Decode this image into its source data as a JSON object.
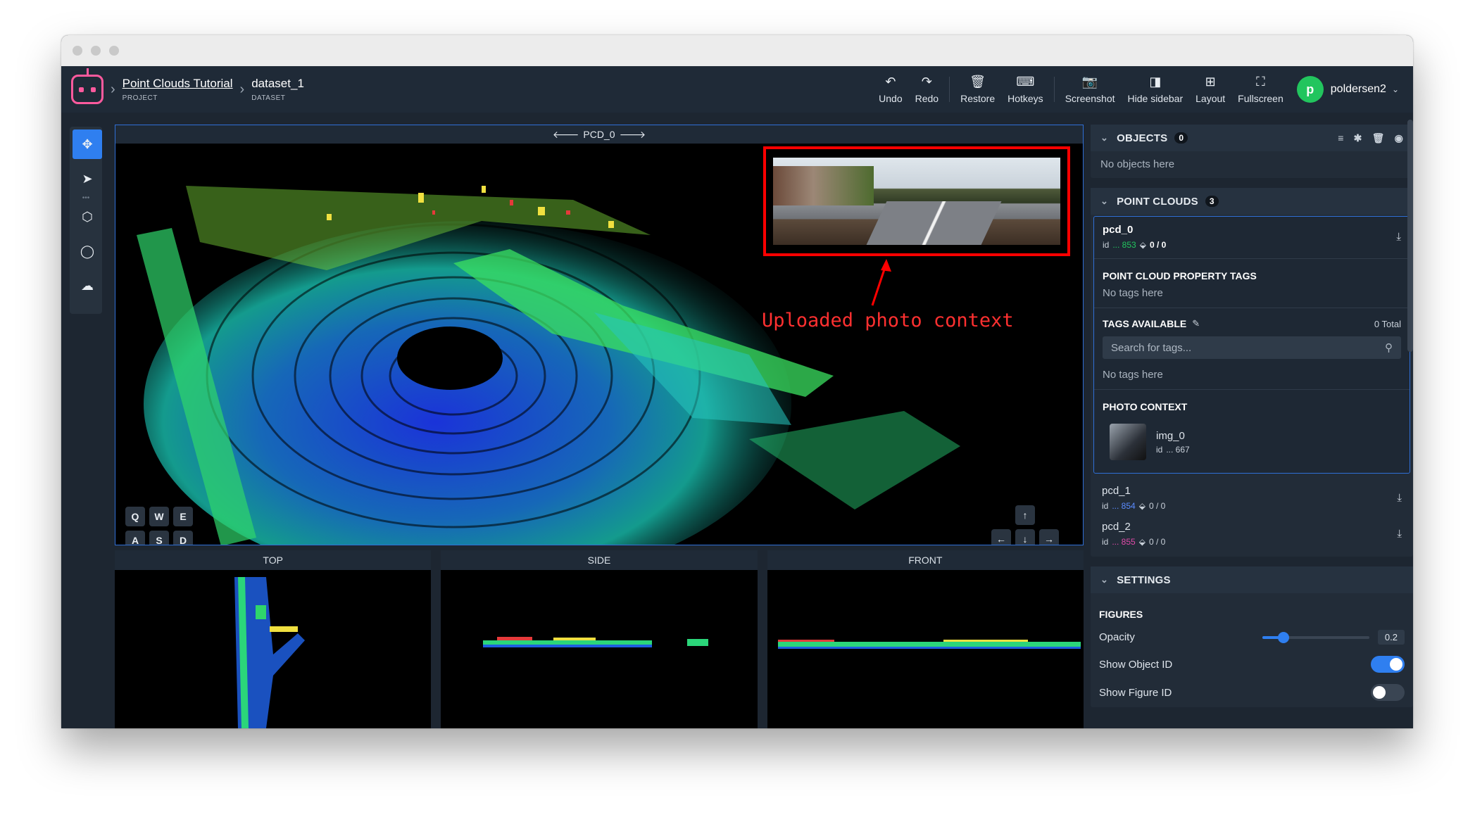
{
  "breadcrumb": {
    "project": {
      "title": "Point Clouds Tutorial",
      "sub": "PROJECT"
    },
    "dataset": {
      "title": "dataset_1",
      "sub": "DATASET"
    }
  },
  "toolbar": {
    "undo": "Undo",
    "redo": "Redo",
    "restore": "Restore",
    "hotkeys": "Hotkeys",
    "screenshot": "Screenshot",
    "hide_sidebar": "Hide sidebar",
    "layout": "Layout",
    "fullscreen": "Fullscreen"
  },
  "user": {
    "initial": "p",
    "name": "poldersen2"
  },
  "viewer": {
    "title": "PCD_0",
    "annotation": "Uploaded photo context",
    "keys_top": [
      "Q",
      "W",
      "E"
    ],
    "keys_bottom": [
      "A",
      "S",
      "D"
    ],
    "views": {
      "top": "TOP",
      "side": "SIDE",
      "front": "FRONT"
    }
  },
  "sidebar": {
    "objects": {
      "title": "OBJECTS",
      "count": "0",
      "empty": "No objects here"
    },
    "point_clouds": {
      "title": "POINT CLOUDS",
      "count": "3",
      "selected": {
        "name": "pcd_0",
        "id_label": "id",
        "id": "... 853",
        "figures": "0 / 0",
        "id_color": "#22c55e",
        "property_tags_title": "POINT CLOUD PROPERTY TAGS",
        "property_tags_empty": "No tags here",
        "tags_available_title": "TAGS AVAILABLE",
        "tags_total": "0 Total",
        "search_placeholder": "Search for tags...",
        "tags_empty": "No tags here",
        "photo_context_title": "PHOTO CONTEXT",
        "photo": {
          "name": "img_0",
          "id_label": "id",
          "id": "... 667"
        }
      },
      "items": [
        {
          "name": "pcd_1",
          "id_label": "id",
          "id": "... 854",
          "figures": "0 / 0",
          "id_color": "#5b8cff"
        },
        {
          "name": "pcd_2",
          "id_label": "id",
          "id": "... 855",
          "figures": "0 / 0",
          "id_color": "#e04aa9"
        }
      ]
    },
    "settings": {
      "title": "SETTINGS",
      "figures_title": "FIGURES",
      "opacity_label": "Opacity",
      "opacity_value": "0.2",
      "opacity_fraction": 0.2,
      "show_object_id_label": "Show Object ID",
      "show_object_id": true,
      "show_figure_id_label": "Show Figure ID",
      "show_figure_id": false
    }
  },
  "colors": {
    "accent": "#2f7ff0",
    "annotation": "#ff0000",
    "avatar": "#22c55e"
  }
}
